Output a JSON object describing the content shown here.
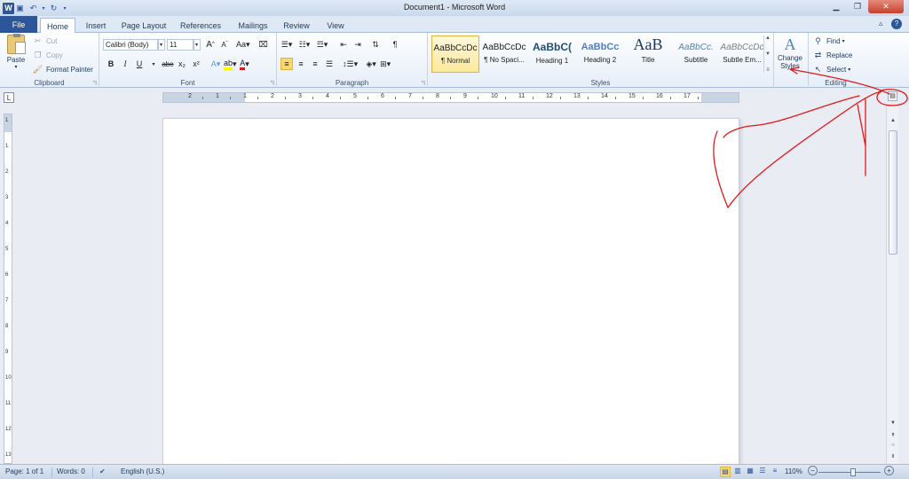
{
  "window": {
    "title": "Document1 - Microsoft Word"
  },
  "qat": {
    "logo": "W",
    "save_icon": "save-icon",
    "undo_icon": "undo-icon",
    "redo_icon": "redo-icon"
  },
  "tabs": [
    {
      "label": "File"
    },
    {
      "label": "Home"
    },
    {
      "label": "Insert"
    },
    {
      "label": "Page Layout"
    },
    {
      "label": "References"
    },
    {
      "label": "Mailings"
    },
    {
      "label": "Review"
    },
    {
      "label": "View"
    }
  ],
  "clipboard": {
    "paste": "Paste",
    "cut": "Cut",
    "copy": "Copy",
    "format_painter": "Format Painter",
    "label": "Clipboard"
  },
  "font": {
    "name": "Calibri (Body)",
    "size": "11",
    "bold": "B",
    "italic": "I",
    "underline": "U",
    "strike": "abe",
    "sub": "x₂",
    "sup": "x²",
    "grow": "A",
    "shrink": "A",
    "case": "Aa",
    "label": "Font"
  },
  "paragraph": {
    "label": "Paragraph",
    "pilcrow": "¶"
  },
  "styles": {
    "label": "Styles",
    "items": [
      {
        "sample": "AaBbCcDc",
        "name": "¶ Normal"
      },
      {
        "sample": "AaBbCcDc",
        "name": "¶ No Spaci..."
      },
      {
        "sample": "AaBbC(",
        "name": "Heading 1"
      },
      {
        "sample": "AaBbCc",
        "name": "Heading 2"
      },
      {
        "sample": "AaB",
        "name": "Title"
      },
      {
        "sample": "AaBbCc.",
        "name": "Subtitle"
      },
      {
        "sample": "AaBbCcDc",
        "name": "Subtle Em..."
      }
    ],
    "change_styles": "Change Styles"
  },
  "editing": {
    "find": "Find",
    "replace": "Replace",
    "select": "Select",
    "label": "Editing"
  },
  "ruler": {
    "labels": [
      "2",
      "1",
      "1",
      "2",
      "3",
      "4",
      "5",
      "6",
      "7",
      "8",
      "9",
      "10",
      "11",
      "12",
      "13",
      "14",
      "15",
      "16",
      "17"
    ]
  },
  "vruler": {
    "labels": [
      "1",
      "1",
      "2",
      "3",
      "4",
      "5",
      "6",
      "7",
      "8",
      "9",
      "10",
      "11",
      "12",
      "13"
    ]
  },
  "status": {
    "page": "Page: 1 of 1",
    "words": "Words: 0",
    "language": "English (U.S.)",
    "zoom": "110%",
    "zoom_minus": "−",
    "zoom_plus": "+",
    "zoom_level_percent": 55
  },
  "colors": {
    "accent": "#2b579a",
    "highlight": "#fbd870",
    "annotation": "#e0191b"
  }
}
